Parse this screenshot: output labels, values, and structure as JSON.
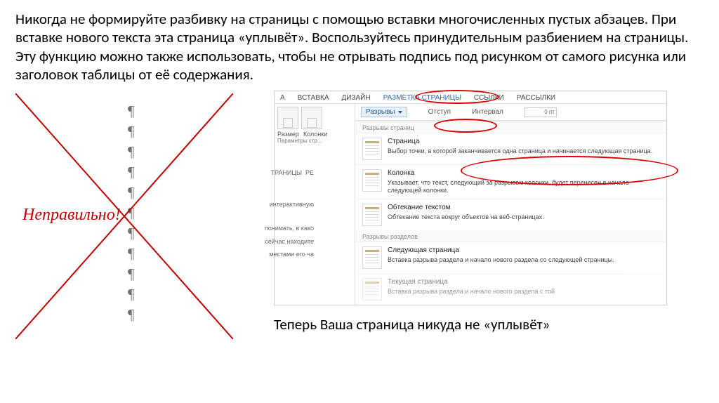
{
  "main_paragraph": "Никогда не формируйте разбивку на страницы с помощью вставки многочисленных пустых абзацев. При вставке нового текста эта страница «уплывёт». Воспользуйтесь принудительным разбиением на страницы. Эту функцию можно также использовать, чтобы не отрывать подпись под рисунком от самого рисунка или заголовок таблицы от её содержания.",
  "wrong_label": "Неправильно!",
  "pilcrow": "¶",
  "ribbon": {
    "tabs": [
      "А",
      "ВСТАВКА",
      "ДИЗАЙН",
      "РАЗМЕТКА СТРАНИЦЫ",
      "ССЫЛКИ",
      "РАССЫЛКИ"
    ],
    "left_group": {
      "size": "Размер",
      "columns": "Колонки",
      "params": "Параметры стр..."
    },
    "breaks_btn": "Разрывы",
    "indent_label": "Отступ",
    "interval_label": "Интервал",
    "spinner_value": "0 пт"
  },
  "menu": {
    "section_pages": "Разрывы страниц",
    "items_pages": [
      {
        "title": "Страница",
        "desc": "Выбор точки, в которой заканчивается одна страница и начинается следующая страница."
      },
      {
        "title": "Колонка",
        "desc": "Указывает, что текст, следующий за разрывом колонки, будет перенесен в начало следующей колонки."
      },
      {
        "title": "Обтекание текстом",
        "desc": "Обтекание текста вокруг объектов на веб-страницах."
      }
    ],
    "section_sections": "Разрывы разделов",
    "items_sections": [
      {
        "title": "Следующая страница",
        "desc": "Вставка разрыва раздела и начало нового раздела со следующей страницы."
      },
      {
        "title": "Текущая страница",
        "desc": "Вставка разрыва раздела и начало нового раздела с той"
      }
    ]
  },
  "doc_fragments": {
    "f1": "ТРАНИЦЫ",
    "f2": "РЕ",
    "f3": "интерактивную",
    "f4": "понимать, в како",
    "f5": "сейчас находите",
    "f6": "местами его ча"
  },
  "caption": "Теперь Ваша страница никуда не «уплывёт»"
}
